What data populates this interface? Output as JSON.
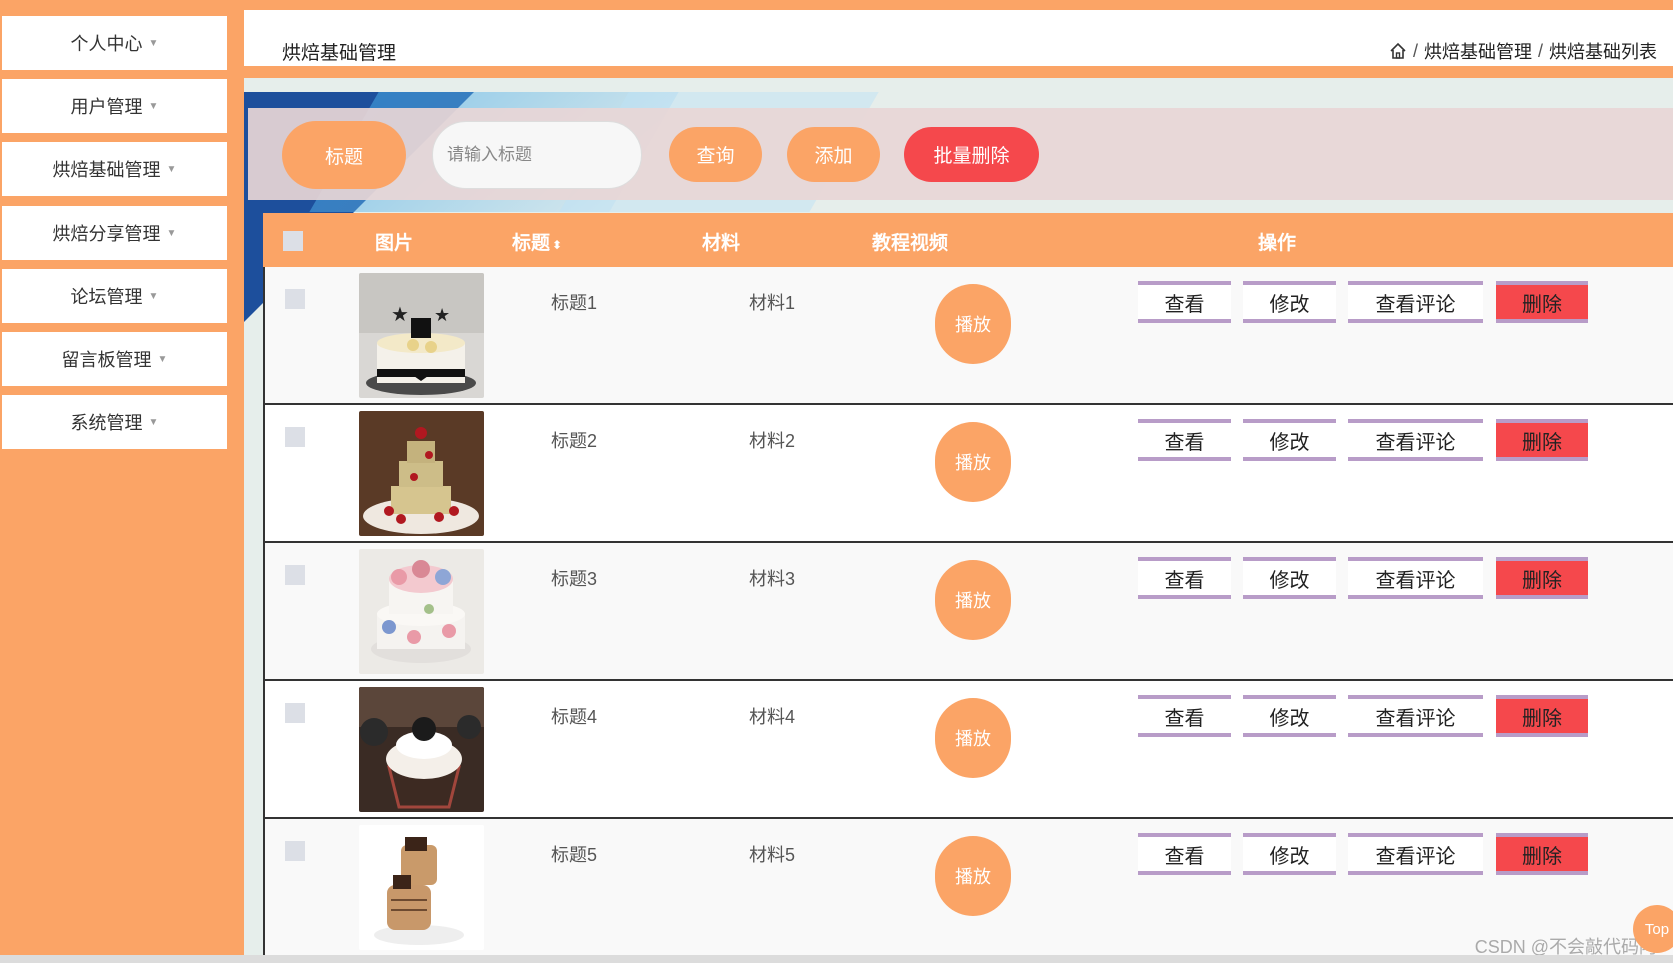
{
  "sidebar": {
    "items": [
      {
        "label": "个人中心"
      },
      {
        "label": "用户管理"
      },
      {
        "label": "烘焙基础管理"
      },
      {
        "label": "烘焙分享管理"
      },
      {
        "label": "论坛管理"
      },
      {
        "label": "留言板管理"
      },
      {
        "label": "系统管理"
      }
    ]
  },
  "header": {
    "title": "烘焙基础管理",
    "breadcrumb": [
      "烘焙基础管理",
      "烘焙基础列表"
    ],
    "breadcrumb_sep": "/"
  },
  "search": {
    "field_label": "标题",
    "placeholder": "请输入标题",
    "query_label": "查询",
    "add_label": "添加",
    "batch_delete_label": "批量删除"
  },
  "table": {
    "columns": {
      "image": "图片",
      "title": "标题",
      "material": "材料",
      "video": "教程视频",
      "actions": "操作"
    },
    "rows": [
      {
        "title": "标题1",
        "material": "材料1",
        "image_icon": "birthday-cake-photo"
      },
      {
        "title": "标题2",
        "material": "材料2",
        "image_icon": "tiered-cake-photo"
      },
      {
        "title": "标题3",
        "material": "材料3",
        "image_icon": "floral-cake-photo"
      },
      {
        "title": "标题4",
        "material": "材料4",
        "image_icon": "cupcake-photo"
      },
      {
        "title": "标题5",
        "material": "材料5",
        "image_icon": "chocolate-dessert-photo"
      }
    ],
    "play_label": "播放",
    "view_label": "查看",
    "edit_label": "修改",
    "comments_label": "查看评论",
    "delete_label": "删除"
  },
  "watermark": "CSDN @不会敲代码阿",
  "top_label": "Top",
  "colors": {
    "accent": "#fba466",
    "danger": "#f5484c",
    "action_border": "#b89cc8"
  }
}
